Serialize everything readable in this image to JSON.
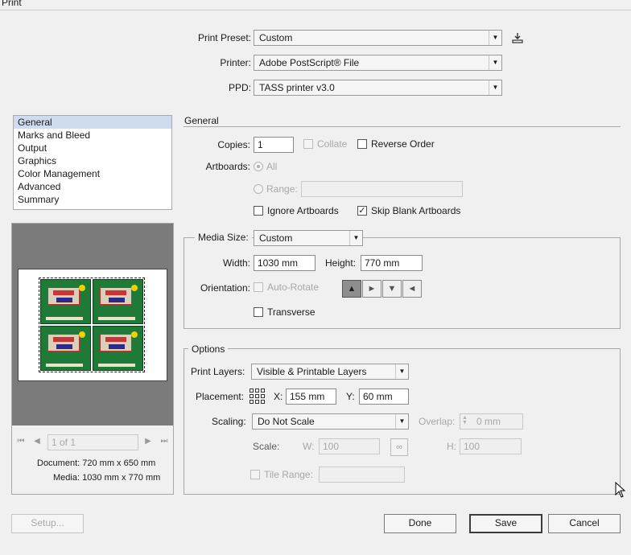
{
  "window": {
    "title": "Print"
  },
  "top": {
    "preset_label": "Print Preset:",
    "preset_value": "Custom",
    "printer_label": "Printer:",
    "printer_value": "Adobe PostScript® File",
    "ppd_label": "PPD:",
    "ppd_value": "TASS printer v3.0"
  },
  "sidebar": {
    "items": [
      {
        "label": "General",
        "selected": true
      },
      {
        "label": "Marks and Bleed"
      },
      {
        "label": "Output"
      },
      {
        "label": "Graphics"
      },
      {
        "label": "Color Management"
      },
      {
        "label": "Advanced"
      },
      {
        "label": "Summary"
      }
    ]
  },
  "preview": {
    "page_indicator": "1 of 1",
    "document_info": "Document: 720 mm x 650 mm",
    "media_info": "Media: 1030 mm x 770 mm"
  },
  "general": {
    "section_title": "General",
    "copies_label": "Copies:",
    "copies_value": "1",
    "collate_label": "Collate",
    "reverse_label": "Reverse Order",
    "artboards_label": "Artboards:",
    "all_label": "All",
    "range_label": "Range:",
    "ignore_label": "Ignore Artboards",
    "skip_label": "Skip Blank Artboards",
    "skip_checked": true
  },
  "media": {
    "size_label": "Media Size:",
    "size_value": "Custom",
    "width_label": "Width:",
    "width_value": "1030 mm",
    "height_label": "Height:",
    "height_value": "770 mm",
    "orientation_label": "Orientation:",
    "autorotate_label": "Auto-Rotate",
    "transverse_label": "Transverse"
  },
  "options": {
    "legend": "Options",
    "layers_label": "Print Layers:",
    "layers_value": "Visible & Printable Layers",
    "placement_label": "Placement:",
    "x_label": "X:",
    "x_value": "155 mm",
    "y_label": "Y:",
    "y_value": "60 mm",
    "scaling_label": "Scaling:",
    "scaling_value": "Do Not Scale",
    "overlap_label": "Overlap:",
    "overlap_value": "0 mm",
    "scale_label": "Scale:",
    "w_label": "W:",
    "w_value": "100",
    "h_label": "H:",
    "h_value": "100",
    "tile_label": "Tile Range:"
  },
  "buttons": {
    "setup": "Setup...",
    "done": "Done",
    "save": "Save",
    "cancel": "Cancel"
  },
  "icons": {
    "save_preset": "save-preset-icon",
    "dropdown": "chevron-down-icon",
    "link": "link-icon",
    "placement": "placement-grid-icon"
  }
}
